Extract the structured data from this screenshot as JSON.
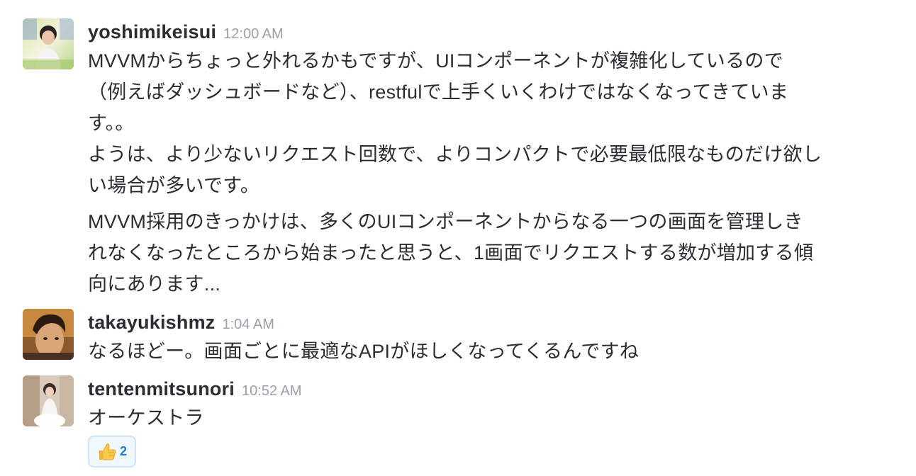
{
  "messages": [
    {
      "username": "yoshimikeisui",
      "time": "12:00 AM",
      "lines": [
        "MVVMからちょっと外れるかもですが、UIコンポーネントが複雑化しているので",
        "（例えばダッシュボードなど）、restfulで上手くいくわけではなくなってきていま",
        "す。。",
        "ようは、より少ないリクエスト回数で、よりコンパクトで必要最低限なものだけ欲し",
        "い場合が多いです。",
        "MVVM採用のきっかけは、多くのUIコンポーネントからなる一つの画面を管理しき",
        "れなくなったところから始まったと思うと、1画面でリクエストする数が増加する傾",
        "向にあります..."
      ]
    },
    {
      "username": "takayukishmz",
      "time": "1:04 AM",
      "lines": [
        "なるほどー。画面ごとに最適なAPIがほしくなってくるんですね"
      ]
    },
    {
      "username": "tentenmitsunori",
      "time": "10:52 AM",
      "lines": [
        "オーケストラ"
      ],
      "reaction": {
        "icon": "thumbs-up-icon",
        "count": "2"
      }
    }
  ],
  "colors": {
    "text": "#2c2d30",
    "timestamp": "#9e9ea6",
    "reaction_bg": "#f0f7fd",
    "reaction_border": "#cfe4f7",
    "reaction_count": "#1d7bd4"
  }
}
